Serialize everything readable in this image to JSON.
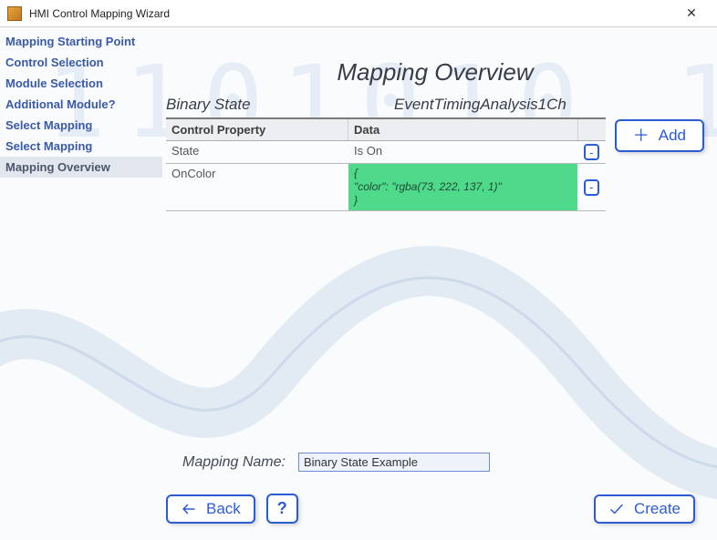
{
  "window": {
    "title": "HMI Control Mapping Wizard"
  },
  "sidebar": {
    "steps": [
      {
        "label": "Mapping Starting Point"
      },
      {
        "label": "Control Selection"
      },
      {
        "label": "Module Selection"
      },
      {
        "label": "Additional Module?"
      },
      {
        "label": "Select Mapping"
      },
      {
        "label": "Select Mapping"
      },
      {
        "label": "Mapping Overview"
      }
    ],
    "active_index": 6
  },
  "main": {
    "title": "Mapping Overview",
    "group_labels": {
      "control": "Binary State",
      "module": "EventTimingAnalysis1Ch"
    },
    "table": {
      "headers": {
        "property": "Control Property",
        "data": "Data"
      },
      "rows": [
        {
          "property": "State",
          "data": "Is On",
          "kind": "plain"
        },
        {
          "property": "OnColor",
          "data": "{\n  \"color\": \"rgba(73, 222, 137, 1)\"\n}",
          "kind": "color"
        }
      ]
    },
    "add_label": "Add",
    "mapping_name": {
      "label": "Mapping Name:",
      "value": "Binary State Example"
    }
  },
  "footer": {
    "back": "Back",
    "help": "?",
    "create": "Create"
  },
  "colors": {
    "accent": "#2a5bd7",
    "oncolor_bg": "#4fd98a"
  }
}
